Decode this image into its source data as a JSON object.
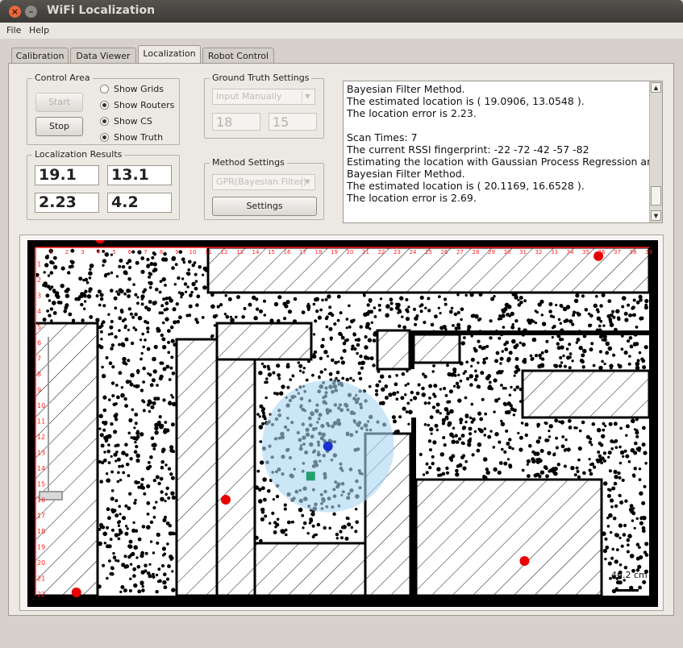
{
  "window": {
    "title": "WiFi Localization"
  },
  "menu": [
    "File",
    "Help"
  ],
  "tabs": [
    "Calibration",
    "Data Viewer",
    "Localization",
    "Robot Control"
  ],
  "control_area": {
    "title": "Control Area",
    "start": "Start",
    "stop": "Stop",
    "options": [
      {
        "label": "Show Grids",
        "checked": false
      },
      {
        "label": "Show Routers",
        "checked": true
      },
      {
        "label": "Show CS",
        "checked": true
      },
      {
        "label": "Show Truth",
        "checked": true
      }
    ]
  },
  "results": {
    "title": "Localization Results",
    "values": [
      "19.1",
      "13.1",
      "2.23",
      "4.2"
    ]
  },
  "ground_truth": {
    "title": "Ground Truth Settings",
    "mode": "Input Manually",
    "x": "18",
    "y": "15"
  },
  "method": {
    "title": "Method Settings",
    "selected": "GPR(Bayesian Filter)",
    "settings_button": "Settings"
  },
  "log": [
    "Bayesian Filter Method.",
    "The estimated location is ( 19.0906, 13.0548 ).",
    "The location error is 2.23.",
    "",
    "Scan Times: 7",
    "The current RSSI fingerprint: -22  -72  -42  -57  -82",
    "Estimating the location with Gaussian Process Regression and",
    "Bayesian Filter Method.",
    "The estimated location is ( 20.1169, 16.6528 ).",
    "The location error is 2.69."
  ],
  "map": {
    "scale_label": "46.2 cm",
    "x_ticks": [
      "1",
      "2",
      "3",
      "4",
      "5",
      "6",
      "7",
      "8",
      "9",
      "10",
      "11",
      "12",
      "13",
      "14",
      "15",
      "16",
      "17",
      "18",
      "19",
      "20",
      "21",
      "22",
      "23",
      "24",
      "25",
      "26",
      "27",
      "28",
      "29",
      "30",
      "31",
      "32",
      "33",
      "34",
      "35",
      "36",
      "37",
      "38",
      "39"
    ],
    "y_ticks": [
      "1",
      "2",
      "3",
      "4",
      "5",
      "6",
      "7",
      "8",
      "9",
      "10",
      "11",
      "12",
      "13",
      "14",
      "15",
      "16",
      "17",
      "18",
      "19",
      "20",
      "21",
      "22"
    ],
    "colors": {
      "grid_ticks": "#ff2020",
      "router": "#e60000",
      "estimate": "#1a2fd0",
      "truth": "#22a070",
      "confidence": "#a9d6f2"
    }
  }
}
